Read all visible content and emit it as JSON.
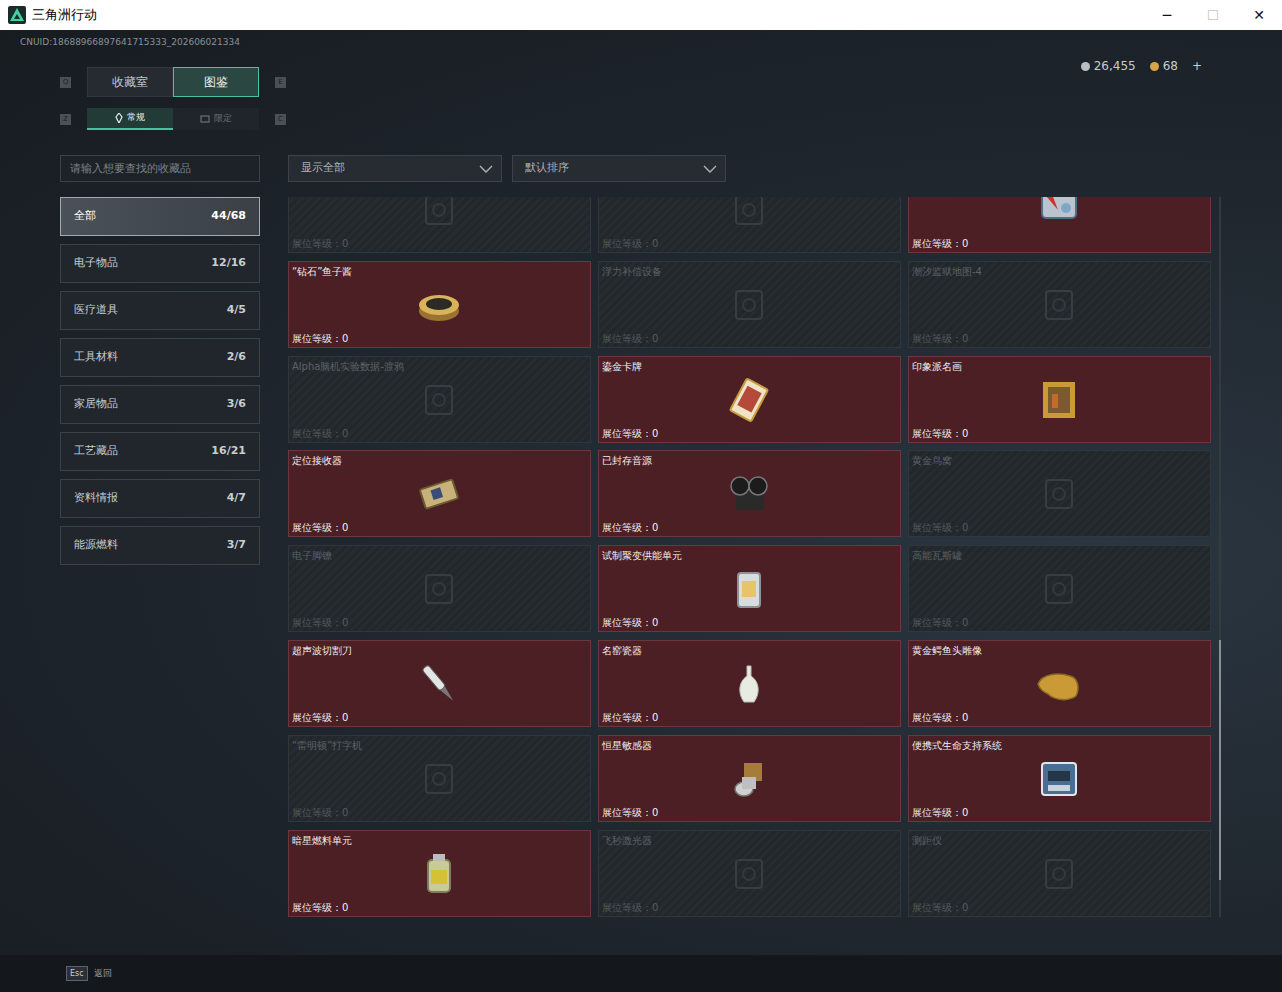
{
  "window": {
    "title": "三角洲行动",
    "controls": [
      {
        "glyph": "─",
        "disabled": false
      },
      {
        "glyph": "☐",
        "disabled": true
      },
      {
        "glyph": "✕",
        "disabled": false
      }
    ]
  },
  "account": {
    "uid": "CNUID:18688966897641715333_202606021334"
  },
  "currency": [
    {
      "amount": "26,455",
      "color": "#b9bec3"
    },
    {
      "amount": "68",
      "color": "#d9a441"
    }
  ],
  "currency_add": "+",
  "tabs": {
    "prev_key": "Q",
    "next_key": "E",
    "items": [
      {
        "label": "收藏室",
        "selected": false
      },
      {
        "label": "图鉴",
        "selected": true
      }
    ]
  },
  "subtabs": {
    "prev_key": "Z",
    "next_key": "C",
    "items": [
      {
        "label": "常规",
        "selected": true
      },
      {
        "label": "限定",
        "selected": false
      }
    ]
  },
  "search": {
    "placeholder": "请输入想要查找的收藏品"
  },
  "filters": [
    {
      "value": "显示全部"
    },
    {
      "value": "默认排序"
    }
  ],
  "sidebar": {
    "items": [
      {
        "label": "全部",
        "count": "44/68",
        "selected": true
      },
      {
        "label": "电子物品",
        "count": "12/16",
        "selected": false
      },
      {
        "label": "医疗道具",
        "count": "4/5",
        "selected": false
      },
      {
        "label": "工具材料",
        "count": "2/6",
        "selected": false
      },
      {
        "label": "家居物品",
        "count": "3/6",
        "selected": false
      },
      {
        "label": "工艺藏品",
        "count": "16/21",
        "selected": false
      },
      {
        "label": "资料情报",
        "count": "4/7",
        "selected": false
      },
      {
        "label": "能源燃料",
        "count": "3/7",
        "selected": false
      }
    ]
  },
  "grid": {
    "items": [
      {
        "name": "",
        "stand": "展位等级：0",
        "owned": false
      },
      {
        "name": "",
        "stand": "展位等级：0",
        "owned": false
      },
      {
        "name": "",
        "stand": "展位等级：0",
        "owned": true
      },
      {
        "name": "“钻石”鱼子酱",
        "stand": "展位等级：0",
        "owned": true
      },
      {
        "name": "浮力补偿设备",
        "stand": "展位等级：0",
        "owned": false
      },
      {
        "name": "潮汐监狱地图-4",
        "stand": "展位等级：0",
        "owned": false
      },
      {
        "name": "Alpha脑机实验数据-渡鸦",
        "stand": "展位等级：0",
        "owned": false
      },
      {
        "name": "鎏金卡牌",
        "stand": "展位等级：0",
        "owned": true
      },
      {
        "name": "印象派名画",
        "stand": "展位等级：0",
        "owned": true
      },
      {
        "name": "定位接收器",
        "stand": "展位等级：0",
        "owned": true
      },
      {
        "name": "已封存音源",
        "stand": "展位等级：0",
        "owned": true
      },
      {
        "name": "黄金鸟窝",
        "stand": "展位等级：0",
        "owned": false
      },
      {
        "name": "电子脚镣",
        "stand": "展位等级：0",
        "owned": false
      },
      {
        "name": "试制聚变供能单元",
        "stand": "展位等级：0",
        "owned": true
      },
      {
        "name": "高能瓦斯罐",
        "stand": "展位等级：0",
        "owned": false
      },
      {
        "name": "超声波切割刀",
        "stand": "展位等级：0",
        "owned": true
      },
      {
        "name": "名窑瓷器",
        "stand": "展位等级：0",
        "owned": true
      },
      {
        "name": "黄金鳄鱼头雕像",
        "stand": "展位等级：0",
        "owned": true
      },
      {
        "name": "“雷明顿”打字机",
        "stand": "展位等级：0",
        "owned": false
      },
      {
        "name": "恒星敏感器",
        "stand": "展位等级：0",
        "owned": true
      },
      {
        "name": "便携式生命支持系统",
        "stand": "展位等级：0",
        "owned": true
      },
      {
        "name": "暗星燃料单元",
        "stand": "展位等级：0",
        "owned": true
      },
      {
        "name": "飞秒激光器",
        "stand": "展位等级：0",
        "owned": false
      },
      {
        "name": "测距仪",
        "stand": "展位等级：0",
        "owned": false
      }
    ]
  },
  "footer": {
    "key": "Esc",
    "label": "返回"
  }
}
